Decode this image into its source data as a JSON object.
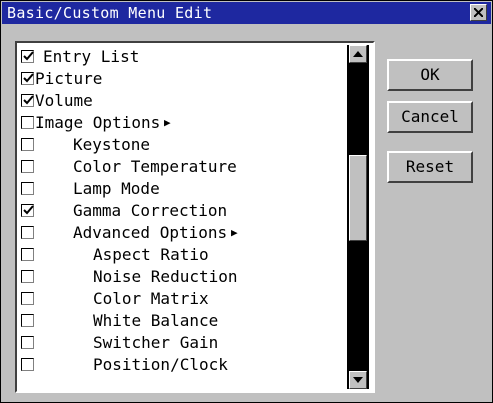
{
  "dialog": {
    "title": "Basic/Custom Menu Edit"
  },
  "list": {
    "items": [
      {
        "label": "Entry List",
        "checked": true
      },
      {
        "label": "Picture",
        "checked": true
      },
      {
        "label": "Volume",
        "checked": true
      },
      {
        "label": "Image Options",
        "checked": false,
        "submenu": true
      },
      {
        "label": "Keystone",
        "checked": false
      },
      {
        "label": "Color Temperature",
        "checked": false
      },
      {
        "label": "Lamp Mode",
        "checked": false
      },
      {
        "label": "Gamma Correction",
        "checked": true
      },
      {
        "label": "Advanced Options",
        "checked": false,
        "submenu": true
      },
      {
        "label": "Aspect Ratio",
        "checked": false
      },
      {
        "label": "Noise Reduction",
        "checked": false
      },
      {
        "label": "Color Matrix",
        "checked": false
      },
      {
        "label": "White Balance",
        "checked": false
      },
      {
        "label": "Switcher Gain",
        "checked": false
      },
      {
        "label": "Position/Clock",
        "checked": false
      }
    ]
  },
  "buttons": {
    "ok": "OK",
    "cancel": "Cancel",
    "reset": "Reset"
  },
  "colors": {
    "titlebar": "#1e28a0",
    "background": "#c0c0c0"
  }
}
